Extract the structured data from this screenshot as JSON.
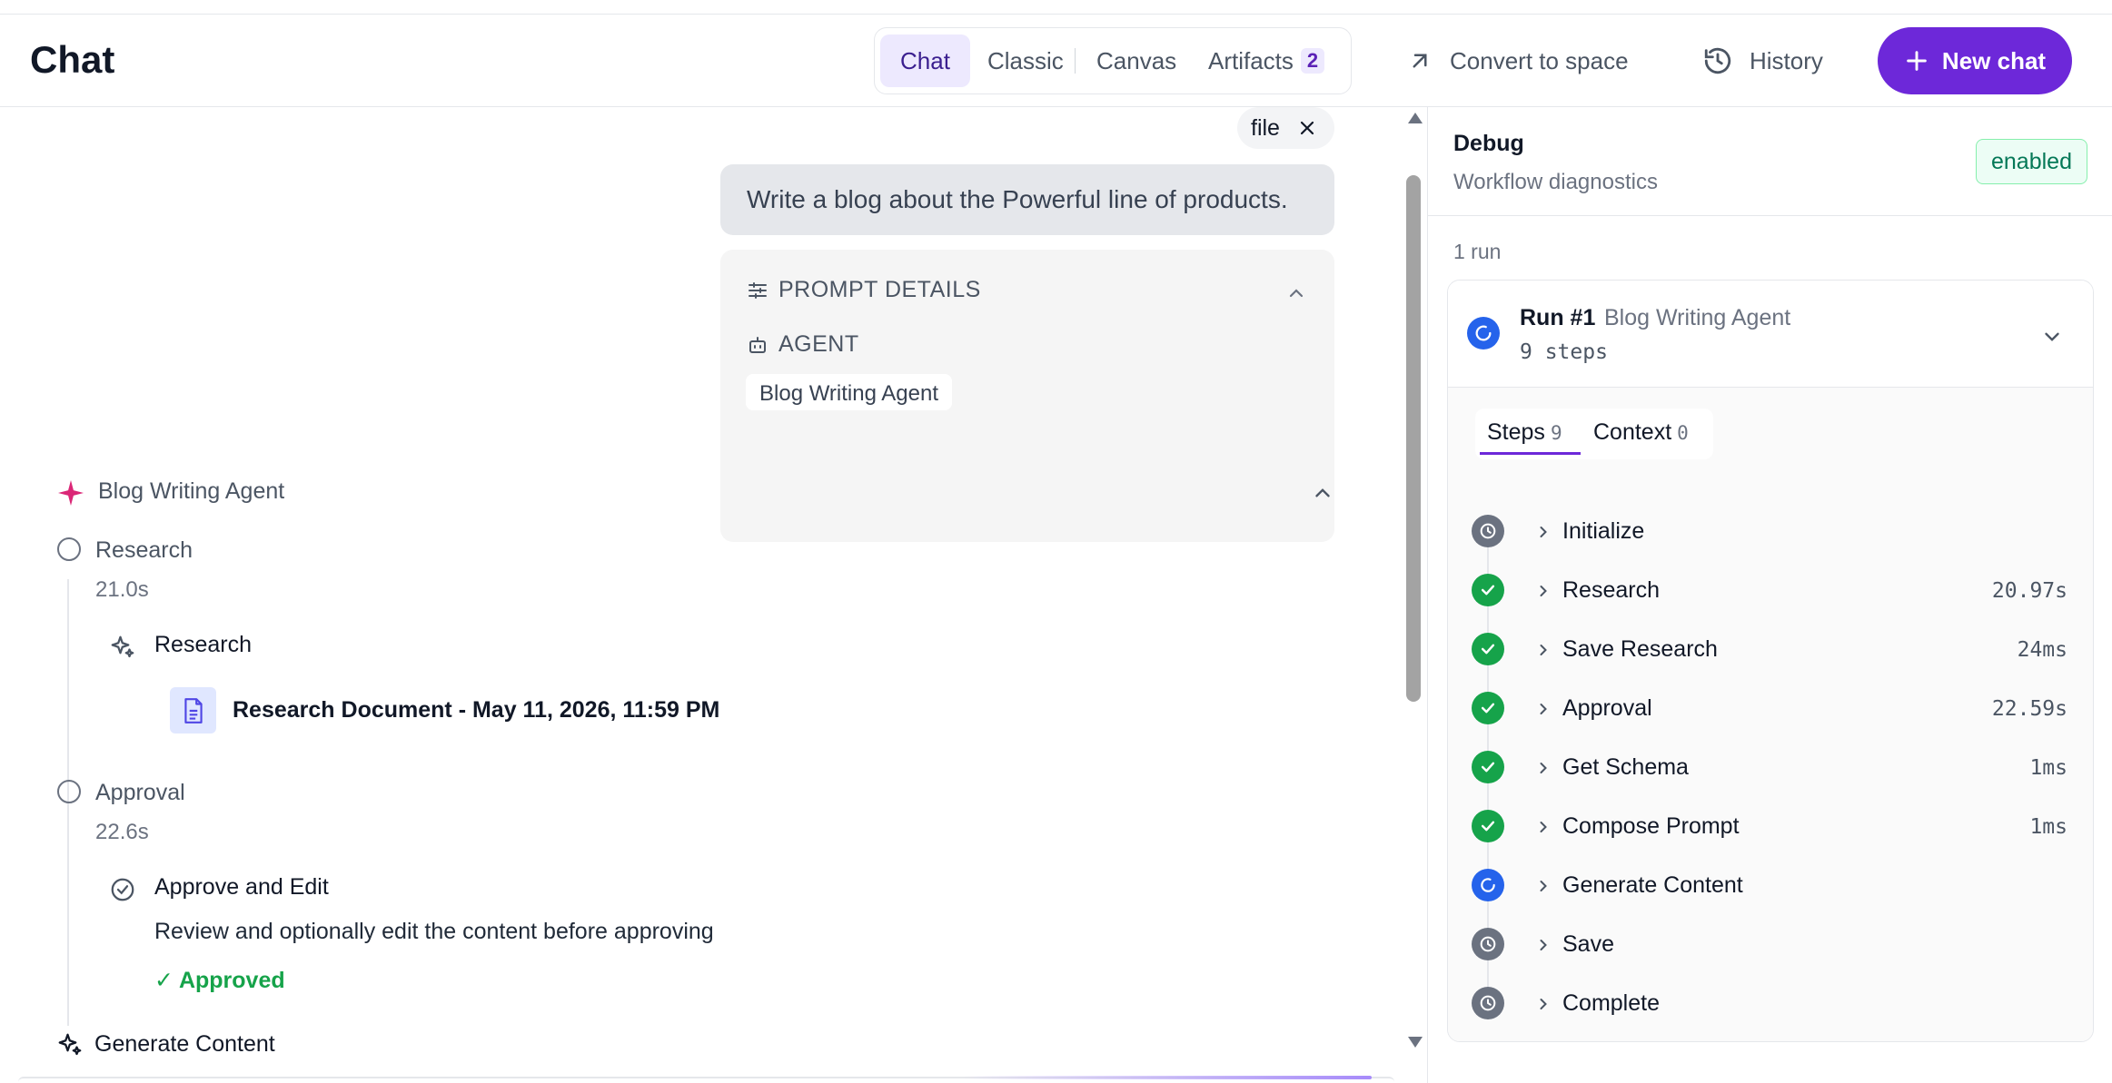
{
  "header": {
    "title": "Chat",
    "tabs": [
      {
        "label": "Chat",
        "active": true
      },
      {
        "label": "Classic"
      },
      {
        "label": "Canvas"
      },
      {
        "label": "Artifacts",
        "count": "2"
      }
    ],
    "convert_label": "Convert to space",
    "history_label": "History",
    "new_chat_label": "New chat"
  },
  "chat": {
    "file_chip": "file",
    "user_message": "Write a blog about the Powerful line of products.",
    "prompt_details": {
      "title": "PROMPT DETAILS",
      "agent_label": "AGENT",
      "agent_value": "Blog Writing Agent"
    },
    "agent_name": "Blog Writing Agent",
    "steps": [
      {
        "name": "Research",
        "time": "21.0s",
        "substep": "Research",
        "document": "Research Document - May 11, 2026, 11:59 PM"
      },
      {
        "name": "Approval",
        "time": "22.6s",
        "substep": "Approve and Edit",
        "description": "Review and optionally edit the content before approving",
        "status": "✓ Approved"
      }
    ],
    "current_step": "Generate Content"
  },
  "debug": {
    "title": "Debug",
    "subtitle": "Workflow diagnostics",
    "status": "enabled",
    "runs_count": "1 run",
    "run": {
      "number": "Run #1",
      "name": "Blog Writing Agent",
      "steps_summary": "9 steps",
      "tabs": [
        {
          "label": "Steps",
          "count": "9"
        },
        {
          "label": "Context",
          "count": "0"
        }
      ],
      "steps": [
        {
          "name": "Initialize",
          "status": "pending",
          "duration": ""
        },
        {
          "name": "Research",
          "status": "done",
          "duration": "20.97s"
        },
        {
          "name": "Save Research",
          "status": "done",
          "duration": "24ms"
        },
        {
          "name": "Approval",
          "status": "done",
          "duration": "22.59s"
        },
        {
          "name": "Get Schema",
          "status": "done",
          "duration": "1ms"
        },
        {
          "name": "Compose Prompt",
          "status": "done",
          "duration": "1ms"
        },
        {
          "name": "Generate Content",
          "status": "running",
          "duration": ""
        },
        {
          "name": "Save",
          "status": "pending",
          "duration": ""
        },
        {
          "name": "Complete",
          "status": "pending",
          "duration": ""
        }
      ]
    }
  },
  "colors": {
    "accent": "#6d28d9",
    "success": "#16a34a",
    "running": "#2563eb",
    "pending": "#6b7280"
  }
}
